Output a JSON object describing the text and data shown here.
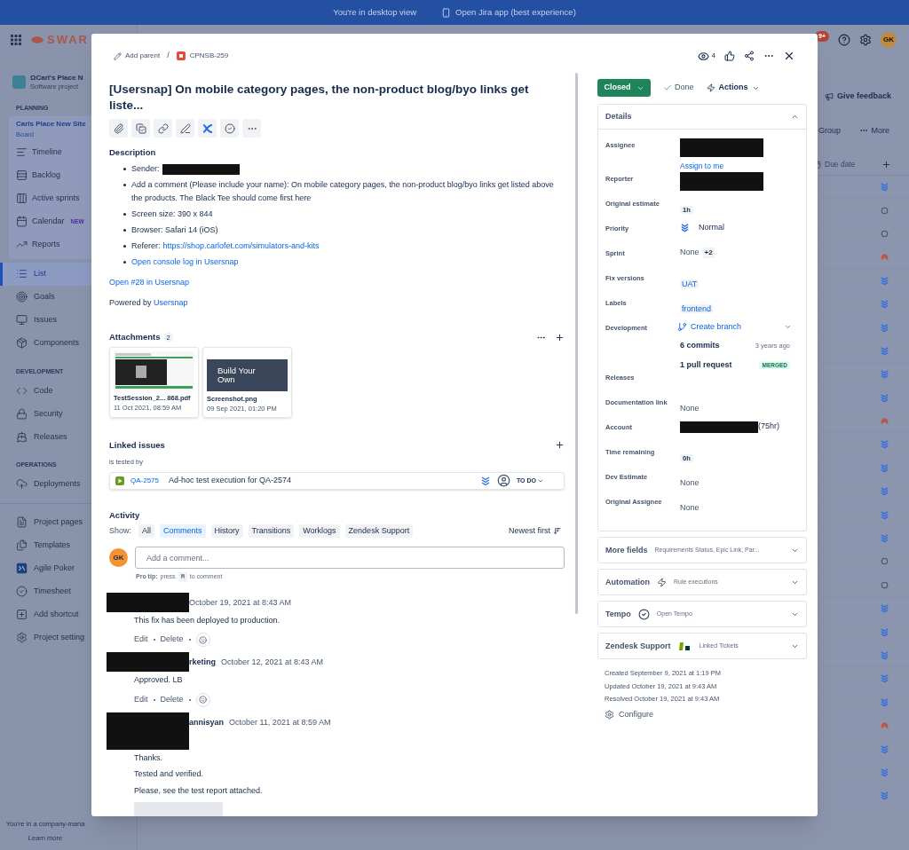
{
  "banner": {
    "text": "You're in desktop view",
    "link": "Open Jira app (best experience)"
  },
  "topbar": {
    "logo_text": "SWAR",
    "notification_count": "9+",
    "avatar": "GK"
  },
  "sidebar": {
    "project_name": "ΩCarl's Place N",
    "project_type": "Software project",
    "groups": [
      {
        "heading": "PLANNING",
        "board": {
          "label": "Carls Place New Site",
          "sublabel": "Board",
          "items": [
            {
              "label": "Timeline",
              "selected": false
            },
            {
              "label": "Backlog",
              "selected": false
            },
            {
              "label": "Active sprints",
              "selected": false
            },
            {
              "label": "Calendar",
              "badge": "NEW",
              "selected": false
            },
            {
              "label": "Reports",
              "selected": false
            }
          ]
        },
        "items": [
          {
            "label": "List",
            "selected": true
          },
          {
            "label": "Goals",
            "selected": false
          },
          {
            "label": "Issues",
            "selected": false
          },
          {
            "label": "Components",
            "selected": false
          }
        ]
      },
      {
        "heading": "DEVELOPMENT",
        "items": [
          {
            "label": "Code",
            "selected": false
          },
          {
            "label": "Security",
            "selected": false
          },
          {
            "label": "Releases",
            "selected": false
          }
        ]
      },
      {
        "heading": "OPERATIONS",
        "items": [
          {
            "label": "Deployments",
            "selected": false
          }
        ]
      },
      {
        "items": [
          {
            "label": "Project pages",
            "selected": false
          },
          {
            "label": "Templates",
            "selected": false
          },
          {
            "label": "Agile Poker",
            "selected": false
          },
          {
            "label": "Timesheet",
            "selected": false
          },
          {
            "label": "Add shortcut",
            "selected": false
          },
          {
            "label": "Project setting",
            "selected": false
          }
        ]
      }
    ],
    "footer": {
      "text": "You're in a company-mana",
      "link": "Learn more"
    }
  },
  "background": {
    "feedback": "Give feedback",
    "group": "Group",
    "more": "More",
    "column": "Due date",
    "rows": [
      {
        "kind": "lowest"
      },
      {
        "kind": "unset"
      },
      {
        "kind": "unset"
      },
      {
        "kind": "highest"
      },
      {
        "kind": "lowest"
      },
      {
        "kind": "lowest"
      },
      {
        "kind": "lowest"
      },
      {
        "kind": "lowest"
      },
      {
        "kind": "lowest"
      },
      {
        "kind": "lowest"
      },
      {
        "kind": "highest"
      },
      {
        "kind": "lowest"
      },
      {
        "kind": "lowest"
      },
      {
        "kind": "lowest"
      },
      {
        "kind": "lowest"
      },
      {
        "kind": "lowest"
      },
      {
        "kind": "unset"
      },
      {
        "kind": "unset"
      },
      {
        "kind": "lowest"
      },
      {
        "kind": "lowest"
      },
      {
        "kind": "lowest"
      },
      {
        "kind": "lowest"
      },
      {
        "kind": "lowest"
      },
      {
        "kind": "highest"
      },
      {
        "kind": "lowest"
      },
      {
        "kind": "lowest"
      },
      {
        "kind": "lowest"
      }
    ]
  },
  "issue": {
    "breadcrumb": {
      "parent": "Add parent",
      "separator": "/",
      "key": "CPNSB-259"
    },
    "watchers": "4",
    "title": "[Usersnap] On mobile category pages, the non-product blog/byo links get liste...",
    "description": {
      "heading": "Description",
      "bullets": [
        {
          "text": "Sender:",
          "redacted": true
        },
        {
          "text": "Add a comment (Please include your name): On mobile category pages, the non-product blog/byo links get listed above the products. The Black Tee should come first here",
          "redacted": false
        },
        {
          "text": "Screen size: 390 x 844",
          "redacted": false
        },
        {
          "text": "Browser: Safari 14 (iOS)",
          "redacted": false
        },
        {
          "text": "Referer:",
          "link": "https://shop.carlofet.com/simulators-and-kits",
          "redacted": false
        },
        {
          "link": "Open console log in Usersnap",
          "redacted": false
        }
      ],
      "paragraphs": [
        {
          "link": "Open #28 in Usersnap"
        },
        {
          "text": "Powered by",
          "link": "Usersnap"
        }
      ]
    },
    "attachments": {
      "heading": "Attachments",
      "count": "2",
      "files": [
        {
          "kind": "pdf",
          "name": "TestSession_2... 868.pdf",
          "date": "11 Oct 2021, 08:59 AM"
        },
        {
          "kind": "image",
          "name": "Screenshot.png",
          "date": "09 Sep 2021, 01:20 PM",
          "preview_text": "Build Your Own"
        }
      ]
    },
    "linked_issues": {
      "heading": "Linked issues",
      "relation": "is tested by",
      "items": [
        {
          "key": "QA-2575",
          "summary": "Ad-hoc test execution for QA-2574",
          "status": "TO DO"
        }
      ]
    },
    "activity": {
      "heading": "Activity",
      "show_label": "Show:",
      "filters": [
        {
          "label": "All",
          "selected": false
        },
        {
          "label": "Comments",
          "selected": true
        },
        {
          "label": "History",
          "selected": false
        },
        {
          "label": "Transitions",
          "selected": false
        },
        {
          "label": "Worklogs",
          "selected": false
        },
        {
          "label": "Zendesk Support",
          "selected": false
        }
      ],
      "sort": "Newest first",
      "composer": {
        "avatar": "GK",
        "placeholder": "Add a comment...",
        "tip": "Pro tip:",
        "tip_before": "press",
        "tip_key": "M",
        "tip_after": "to comment"
      },
      "comments": [
        {
          "date": "October 19, 2021 at 8:43 AM",
          "body": [
            "This fix has been deployed to production."
          ],
          "actions": [
            "Edit",
            "Delete"
          ],
          "has_attachment": false
        },
        {
          "author": "rketing",
          "date": "October 12, 2021 at 8:43 AM",
          "body": [
            "Approved. LB"
          ],
          "actions": [
            "Edit",
            "Delete"
          ],
          "has_attachment": false
        },
        {
          "author": "annisyan",
          "date": "October 11, 2021 at 8:59 AM",
          "body": [
            "Thanks.",
            "Tested and verified.",
            "Please, see the test report attached."
          ],
          "has_attachment": true
        }
      ]
    }
  },
  "side": {
    "status": "Closed",
    "resolution": "Done",
    "actions": "Actions",
    "details": {
      "heading": "Details",
      "expanded": true,
      "fields": [
        {
          "kind": "user",
          "label": "Assignee",
          "redacted": true,
          "link": "Assign to me"
        },
        {
          "kind": "user",
          "label": "Reporter",
          "redacted": true
        },
        {
          "kind": "chip",
          "label": "Original estimate",
          "value": "1h"
        },
        {
          "kind": "priority",
          "label": "Priority",
          "value": "Normal"
        },
        {
          "kind": "sprint",
          "label": "Sprint",
          "value": "None",
          "extra": "+2"
        },
        {
          "kind": "tag",
          "label": "Fix versions",
          "value": "UAT"
        },
        {
          "kind": "tag",
          "label": "Labels",
          "value": "frontend"
        },
        {
          "kind": "development",
          "label": "Development",
          "value": "Create branch",
          "commits": "6 commits",
          "commits_time": "3 years ago",
          "pull_requests": "1 pull request",
          "pr_status": "MERGED"
        },
        {
          "kind": "empty",
          "label": "Releases"
        },
        {
          "kind": "text",
          "label": "Documentation link",
          "value": "None"
        },
        {
          "kind": "account",
          "label": "Account",
          "value": "(75hr)",
          "redacted": true
        },
        {
          "kind": "chip",
          "label": "Time remaining",
          "value": "0h"
        },
        {
          "kind": "text",
          "label": "Dev Estimate",
          "value": "None"
        },
        {
          "kind": "text",
          "label": "Original Assignee",
          "value": "None"
        }
      ]
    },
    "panels": [
      {
        "kind": "more",
        "title": "More fields",
        "subtitle": "Requirements Status, Epic Link, Par...",
        "expanded": false
      },
      {
        "kind": "automation",
        "title": "Automation",
        "subtitle": "Rule executions",
        "expanded": false
      },
      {
        "kind": "tempo",
        "title": "Tempo",
        "subtitle": "Open Tempo",
        "expanded": false
      },
      {
        "kind": "zendesk",
        "title": "Zendesk Support",
        "subtitle": "Linked Tickets",
        "expanded": false
      }
    ],
    "dates": [
      "Created September 9, 2021 at 1:19 PM",
      "Updated October 19, 2021 at 9:43 AM",
      "Resolved October 19, 2021 at 9:43 AM"
    ],
    "configure": "Configure"
  }
}
